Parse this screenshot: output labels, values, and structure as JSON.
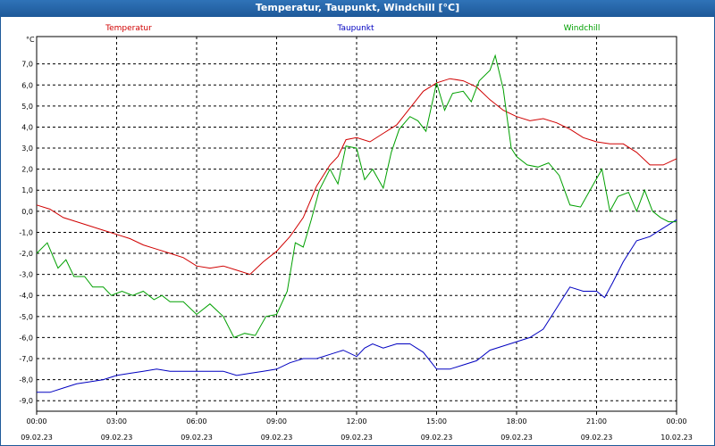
{
  "window": {
    "title": "Temperatur, Taupunkt, Windchill [°C]"
  },
  "colors": {
    "temperatur": "#d00000",
    "taupunkt": "#0000c0",
    "windchill": "#00a000",
    "grid": "#000000"
  },
  "chart_data": {
    "type": "line",
    "title": "Temperatur, Taupunkt, Windchill [°C]",
    "y_unit": "°C",
    "ylim": [
      -9.5,
      8.3
    ],
    "yticks": [
      "7,0",
      "6,0",
      "5,0",
      "4,0",
      "3,0",
      "2,0",
      "1,0",
      "0,0",
      "-1,0",
      "-2,0",
      "-3,0",
      "-4,0",
      "-5,0",
      "-6,0",
      "-7,0",
      "-8,0",
      "-9,0"
    ],
    "yticks_values": [
      7,
      6,
      5,
      4,
      3,
      2,
      1,
      0,
      -1,
      -2,
      -3,
      -4,
      -5,
      -6,
      -7,
      -8,
      -9
    ],
    "xlim": [
      0,
      24
    ],
    "xticks": [
      {
        "x": 0,
        "time": "00:00",
        "date": "09.02.23"
      },
      {
        "x": 3,
        "time": "03:00",
        "date": "09.02.23"
      },
      {
        "x": 6,
        "time": "06:00",
        "date": "09.02.23"
      },
      {
        "x": 9,
        "time": "09:00",
        "date": "09.02.23"
      },
      {
        "x": 12,
        "time": "12:00",
        "date": "09.02.23"
      },
      {
        "x": 15,
        "time": "15:00",
        "date": "09.02.23"
      },
      {
        "x": 18,
        "time": "18:00",
        "date": "09.02.23"
      },
      {
        "x": 21,
        "time": "21:00",
        "date": "09.02.23"
      },
      {
        "x": 24,
        "time": "00:00",
        "date": "10.02.23"
      }
    ],
    "grid": true,
    "legend_position": "top",
    "series": [
      {
        "name": "Temperatur",
        "color": "#d00000",
        "points": [
          [
            0,
            0.3
          ],
          [
            0.5,
            0.1
          ],
          [
            1,
            -0.3
          ],
          [
            1.5,
            -0.5
          ],
          [
            2,
            -0.7
          ],
          [
            2.5,
            -0.9
          ],
          [
            3,
            -1.1
          ],
          [
            3.5,
            -1.3
          ],
          [
            4,
            -1.6
          ],
          [
            4.5,
            -1.8
          ],
          [
            5,
            -2.0
          ],
          [
            5.5,
            -2.2
          ],
          [
            6,
            -2.6
          ],
          [
            6.5,
            -2.7
          ],
          [
            7,
            -2.6
          ],
          [
            7.5,
            -2.8
          ],
          [
            8,
            -3.0
          ],
          [
            8.5,
            -2.4
          ],
          [
            9,
            -1.9
          ],
          [
            9.5,
            -1.2
          ],
          [
            10,
            -0.3
          ],
          [
            10.5,
            1.2
          ],
          [
            11,
            2.2
          ],
          [
            11.3,
            2.6
          ],
          [
            11.6,
            3.4
          ],
          [
            12,
            3.5
          ],
          [
            12.5,
            3.3
          ],
          [
            13,
            3.7
          ],
          [
            13.5,
            4.1
          ],
          [
            14,
            4.9
          ],
          [
            14.5,
            5.7
          ],
          [
            15,
            6.1
          ],
          [
            15.5,
            6.3
          ],
          [
            16,
            6.2
          ],
          [
            16.5,
            5.9
          ],
          [
            17,
            5.3
          ],
          [
            17.5,
            4.8
          ],
          [
            18,
            4.5
          ],
          [
            18.5,
            4.3
          ],
          [
            19,
            4.4
          ],
          [
            19.5,
            4.2
          ],
          [
            20,
            3.9
          ],
          [
            20.5,
            3.5
          ],
          [
            21,
            3.3
          ],
          [
            21.5,
            3.2
          ],
          [
            22,
            3.2
          ],
          [
            22.5,
            2.8
          ],
          [
            23,
            2.2
          ],
          [
            23.5,
            2.2
          ],
          [
            24,
            2.5
          ]
        ]
      },
      {
        "name": "Taupunkt",
        "color": "#0000c0",
        "points": [
          [
            0,
            -8.6
          ],
          [
            0.5,
            -8.6
          ],
          [
            1,
            -8.4
          ],
          [
            1.5,
            -8.2
          ],
          [
            2,
            -8.1
          ],
          [
            2.5,
            -8.0
          ],
          [
            3,
            -7.8
          ],
          [
            3.5,
            -7.7
          ],
          [
            4,
            -7.6
          ],
          [
            4.5,
            -7.5
          ],
          [
            5,
            -7.6
          ],
          [
            5.5,
            -7.6
          ],
          [
            6,
            -7.6
          ],
          [
            6.5,
            -7.6
          ],
          [
            7,
            -7.6
          ],
          [
            7.5,
            -7.8
          ],
          [
            8,
            -7.7
          ],
          [
            8.5,
            -7.6
          ],
          [
            9,
            -7.5
          ],
          [
            9.5,
            -7.2
          ],
          [
            10,
            -7.0
          ],
          [
            10.5,
            -7.0
          ],
          [
            11,
            -6.8
          ],
          [
            11.5,
            -6.6
          ],
          [
            12,
            -6.9
          ],
          [
            12.3,
            -6.5
          ],
          [
            12.6,
            -6.3
          ],
          [
            13,
            -6.5
          ],
          [
            13.5,
            -6.3
          ],
          [
            14,
            -6.3
          ],
          [
            14.5,
            -6.7
          ],
          [
            15,
            -7.5
          ],
          [
            15.5,
            -7.5
          ],
          [
            16,
            -7.3
          ],
          [
            16.5,
            -7.1
          ],
          [
            17,
            -6.6
          ],
          [
            17.5,
            -6.4
          ],
          [
            18,
            -6.2
          ],
          [
            18.5,
            -6.0
          ],
          [
            19,
            -5.6
          ],
          [
            19.5,
            -4.6
          ],
          [
            20,
            -3.6
          ],
          [
            20.5,
            -3.8
          ],
          [
            21,
            -3.8
          ],
          [
            21.3,
            -4.1
          ],
          [
            21.6,
            -3.4
          ],
          [
            22,
            -2.4
          ],
          [
            22.5,
            -1.4
          ],
          [
            23,
            -1.2
          ],
          [
            23.5,
            -0.8
          ],
          [
            24,
            -0.4
          ]
        ]
      },
      {
        "name": "Windchill",
        "color": "#00a000",
        "points": [
          [
            0,
            -2.0
          ],
          [
            0.4,
            -1.5
          ],
          [
            0.8,
            -2.7
          ],
          [
            1.1,
            -2.3
          ],
          [
            1.4,
            -3.1
          ],
          [
            1.8,
            -3.1
          ],
          [
            2.1,
            -3.6
          ],
          [
            2.5,
            -3.6
          ],
          [
            2.8,
            -4.0
          ],
          [
            3.2,
            -3.8
          ],
          [
            3.6,
            -4.0
          ],
          [
            4.0,
            -3.8
          ],
          [
            4.4,
            -4.2
          ],
          [
            4.7,
            -4.0
          ],
          [
            5.0,
            -4.3
          ],
          [
            5.5,
            -4.3
          ],
          [
            6.0,
            -4.9
          ],
          [
            6.5,
            -4.4
          ],
          [
            7.0,
            -5.0
          ],
          [
            7.4,
            -6.0
          ],
          [
            7.8,
            -5.8
          ],
          [
            8.2,
            -5.9
          ],
          [
            8.6,
            -5.0
          ],
          [
            9.0,
            -4.9
          ],
          [
            9.4,
            -3.8
          ],
          [
            9.7,
            -1.5
          ],
          [
            10.0,
            -1.7
          ],
          [
            10.3,
            -0.4
          ],
          [
            10.6,
            1.0
          ],
          [
            11.0,
            2.0
          ],
          [
            11.3,
            1.3
          ],
          [
            11.6,
            3.1
          ],
          [
            12.0,
            3.0
          ],
          [
            12.3,
            1.5
          ],
          [
            12.6,
            2.0
          ],
          [
            13.0,
            1.1
          ],
          [
            13.3,
            2.8
          ],
          [
            13.6,
            3.9
          ],
          [
            14.0,
            4.5
          ],
          [
            14.3,
            4.3
          ],
          [
            14.6,
            3.8
          ],
          [
            15.0,
            6.1
          ],
          [
            15.3,
            4.8
          ],
          [
            15.6,
            5.6
          ],
          [
            16.0,
            5.7
          ],
          [
            16.3,
            5.2
          ],
          [
            16.6,
            6.2
          ],
          [
            17.0,
            6.7
          ],
          [
            17.2,
            7.4
          ],
          [
            17.5,
            5.8
          ],
          [
            17.8,
            3.0
          ],
          [
            18.0,
            2.6
          ],
          [
            18.4,
            2.2
          ],
          [
            18.8,
            2.1
          ],
          [
            19.2,
            2.3
          ],
          [
            19.6,
            1.7
          ],
          [
            20.0,
            0.3
          ],
          [
            20.4,
            0.2
          ],
          [
            20.8,
            1.1
          ],
          [
            21.2,
            2.0
          ],
          [
            21.5,
            0.0
          ],
          [
            21.8,
            0.7
          ],
          [
            22.2,
            0.9
          ],
          [
            22.5,
            0.0
          ],
          [
            22.8,
            1.0
          ],
          [
            23.1,
            0.0
          ],
          [
            23.4,
            -0.3
          ],
          [
            23.7,
            -0.5
          ],
          [
            24,
            -0.5
          ]
        ]
      }
    ]
  }
}
